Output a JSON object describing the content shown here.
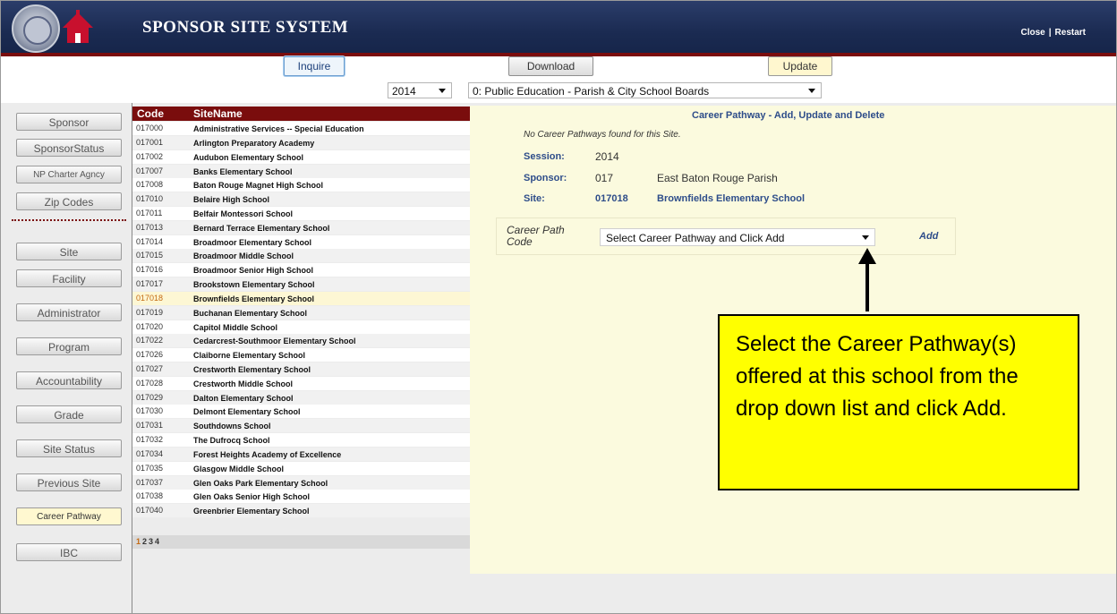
{
  "header": {
    "title": "SPONSOR SITE SYSTEM",
    "close_label": "Close",
    "separator": "|",
    "restart_label": "Restart"
  },
  "toolbar": {
    "inquire_label": "Inquire",
    "download_label": "Download",
    "update_label": "Update",
    "year_value": "2014",
    "sponsor_type_value": "0: Public Education - Parish & City School Boards"
  },
  "sidebar": {
    "items": [
      {
        "label": "Sponsor"
      },
      {
        "label": "SponsorStatus"
      },
      {
        "label": "NP Charter Agncy"
      },
      {
        "label": "Zip Codes"
      },
      {
        "label": "Site"
      },
      {
        "label": "Facility"
      },
      {
        "label": "Administrator"
      },
      {
        "label": "Program"
      },
      {
        "label": "Accountability"
      },
      {
        "label": "Grade"
      },
      {
        "label": "Site Status"
      },
      {
        "label": "Previous Site"
      },
      {
        "label": "Career Pathway"
      },
      {
        "label": "IBC"
      }
    ],
    "active_item": "Career Pathway"
  },
  "site_list": {
    "columns": [
      "Code",
      "SiteName"
    ],
    "rows": [
      {
        "code": "017000",
        "name": "Administrative Services -- Special Education"
      },
      {
        "code": "017001",
        "name": "Arlington Preparatory Academy"
      },
      {
        "code": "017002",
        "name": "Audubon Elementary School"
      },
      {
        "code": "017007",
        "name": "Banks Elementary School"
      },
      {
        "code": "017008",
        "name": "Baton Rouge Magnet High School"
      },
      {
        "code": "017010",
        "name": "Belaire High School"
      },
      {
        "code": "017011",
        "name": "Belfair Montessori School"
      },
      {
        "code": "017013",
        "name": "Bernard Terrace Elementary School"
      },
      {
        "code": "017014",
        "name": "Broadmoor Elementary School"
      },
      {
        "code": "017015",
        "name": "Broadmoor Middle School"
      },
      {
        "code": "017016",
        "name": "Broadmoor Senior High School"
      },
      {
        "code": "017017",
        "name": "Brookstown Elementary School"
      },
      {
        "code": "017018",
        "name": "Brownfields Elementary School"
      },
      {
        "code": "017019",
        "name": "Buchanan Elementary School"
      },
      {
        "code": "017020",
        "name": "Capitol Middle School"
      },
      {
        "code": "017022",
        "name": "Cedarcrest-Southmoor Elementary School"
      },
      {
        "code": "017026",
        "name": "Claiborne Elementary School"
      },
      {
        "code": "017027",
        "name": "Crestworth Elementary School"
      },
      {
        "code": "017028",
        "name": "Crestworth Middle School"
      },
      {
        "code": "017029",
        "name": "Dalton Elementary School"
      },
      {
        "code": "017030",
        "name": "Delmont Elementary School"
      },
      {
        "code": "017031",
        "name": "Southdowns School"
      },
      {
        "code": "017032",
        "name": "The Dufrocq School"
      },
      {
        "code": "017034",
        "name": "Forest Heights Academy of Excellence"
      },
      {
        "code": "017035",
        "name": "Glasgow Middle School"
      },
      {
        "code": "017037",
        "name": "Glen Oaks Park Elementary School"
      },
      {
        "code": "017038",
        "name": "Glen Oaks Senior High School"
      },
      {
        "code": "017040",
        "name": "Greenbrier Elementary School"
      }
    ],
    "selected_code": "017018",
    "pages": [
      "1",
      "2",
      "3",
      "4"
    ],
    "current_page": "1"
  },
  "detail": {
    "title": "Career Pathway - Add, Update and Delete",
    "message": "No Career Pathways found for this Site.",
    "session_label": "Session:",
    "session_value": "2014",
    "sponsor_label": "Sponsor:",
    "sponsor_code": "017",
    "sponsor_name": "East Baton Rouge Parish",
    "site_label": "Site:",
    "site_code": "017018",
    "site_name": "Brownfields Elementary School",
    "career_path_label": "Career Path Code",
    "career_select_value": "Select Career Pathway and Click Add",
    "add_label": "Add"
  },
  "annotation": {
    "text": "Select the Career Pathway(s) offered at this school from the drop down list and click Add."
  },
  "colors": {
    "header_bg": "#1b2b52",
    "header_rule": "#7a0d0d",
    "list_header": "#7a0d0d",
    "link_blue": "#2e4d8a",
    "panel_bg": "#fbfade",
    "callout_bg": "#ffff00",
    "selected_code": "#c46a12"
  }
}
